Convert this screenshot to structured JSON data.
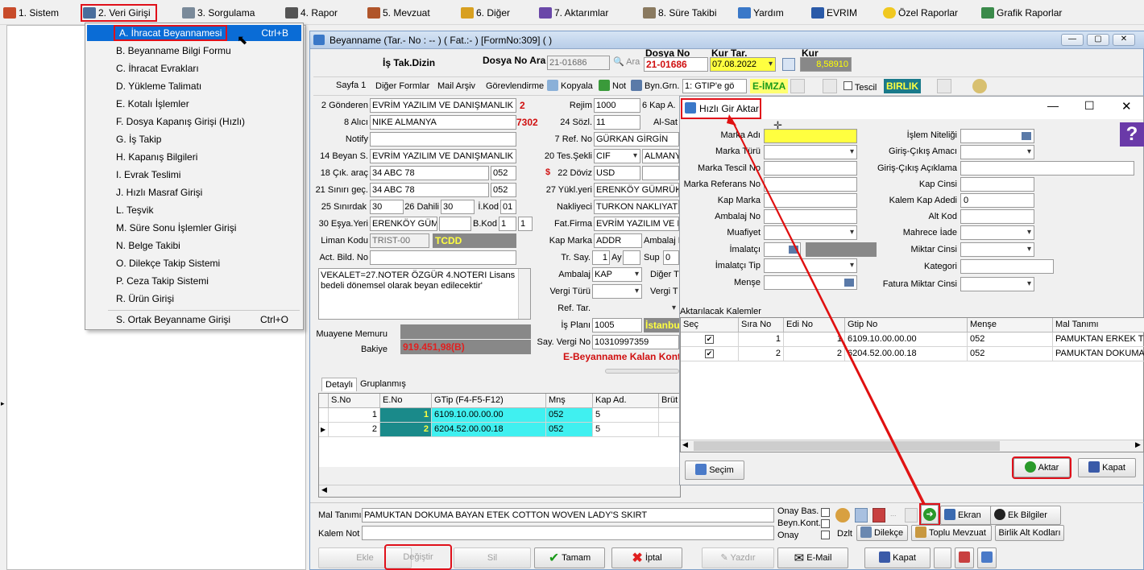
{
  "menubar": {
    "items": [
      {
        "label": "1.  Sistem",
        "icon": "system-icon"
      },
      {
        "label": "2.  Veri Girişi",
        "icon": "data-entry-icon"
      },
      {
        "label": "3.  Sorgulama",
        "icon": "query-icon"
      },
      {
        "label": "4.  Rapor",
        "icon": "printer-icon"
      },
      {
        "label": "5.  Mevzuat",
        "icon": "books-icon"
      },
      {
        "label": "6.  Diğer",
        "icon": "other-icon"
      },
      {
        "label": "7.  Aktarımlar",
        "icon": "transfer-icon"
      },
      {
        "label": "8. Süre Takibi",
        "icon": "clipboard-icon"
      },
      {
        "label": "Yardım",
        "icon": "help-icon"
      },
      {
        "label": "EVRIM",
        "icon": "evrim-icon"
      },
      {
        "label": "Özel Raporlar",
        "icon": "star-icon"
      },
      {
        "label": "Grafik Raporlar",
        "icon": "chart-icon"
      }
    ]
  },
  "dropdown": {
    "items": [
      {
        "label": "A.  İhracat Beyannamesi",
        "shortcut": "Ctrl+B"
      },
      {
        "label": "B.  Beyanname Bilgi Formu"
      },
      {
        "label": "C.  İhracat Evrakları"
      },
      {
        "label": "D.  Yükleme Talimatı"
      },
      {
        "label": "E.  Kotalı İşlemler"
      },
      {
        "label": "F.  Dosya Kapanış Girişi (Hızlı)"
      },
      {
        "label": "G.  İş Takip"
      },
      {
        "label": "H.  Kapanış Bilgileri"
      },
      {
        "label": "I.  Evrak Teslimi"
      },
      {
        "label": "J.  Hızlı Masraf Girişi"
      },
      {
        "label": "L.  Teşvik"
      },
      {
        "label": "M.  Süre Sonu İşlemler Girişi"
      },
      {
        "label": "N.  Belge Takibi"
      },
      {
        "label": "O.  Dilekçe Takip Sistemi"
      },
      {
        "label": "P.  Ceza Takip Sistemi"
      },
      {
        "label": "R.  Ürün Girişi"
      },
      {
        "label": "S.  Ortak Beyanname Girişi",
        "shortcut": "Ctrl+O"
      }
    ]
  },
  "window": {
    "title": "Beyanname (Tar.- No : -- ) ( Fat.:- ) [FormNo:309] ( )",
    "is_takip_label": "İş Tak.Dizin",
    "dosya_no_ara_label": "Dosya No Ara",
    "dosya_no_search": "21-01686",
    "ara_label": "Ara",
    "dosya_no_label": "Dosya No",
    "dosya_no": "21-01686",
    "kur_tar_label": "Kur Tar.",
    "kur_tar": "07.08.2022",
    "kur_label": "Kur",
    "kur": "8,58910"
  },
  "toolbar": {
    "sayfa1": "Sayfa 1",
    "diger_formlar": "Diğer Formlar",
    "mail_arsiv": "Mail Arşiv",
    "gorevlendirme": "Görevlendirme",
    "kopyala": "Kopyala",
    "not": "Not",
    "byn_grn": "Byn.Grn.",
    "gtip_select": "1: GTIP'e gö",
    "e_imza": "E-İMZA",
    "tescil": "Tescil",
    "birlik": "BIRLIK"
  },
  "form": {
    "gonderen_label": "2 Gönderen",
    "gonderen": "EVRİM YAZILIM VE DANIŞMANLIK L",
    "gonderen_code": "2",
    "alici_label": "8 Alıcı",
    "alici": "NIKE ALMANYA",
    "alici_code": "7302",
    "notify_label": "Notify",
    "notify": "",
    "beyan_label": "14 Beyan S.",
    "beyan": "EVRİM YAZILIM VE DANIŞMANLIK",
    "cik_arac_label": "18 Çık. araç",
    "cik_arac": "34 ABC 78",
    "cik_arac_code": "052",
    "sinir_gec_label": "21 Sınırı geç.",
    "sinir_gec": "34 ABC 78",
    "sinir_gec_code": "052",
    "sinirdak_label": "25 Sınırdak",
    "sinirdak": "30",
    "dahili_label": "26 Dahili",
    "dahili": "30",
    "ikod_label": "İ.Kod",
    "ikod": "01",
    "esya_yeri_label": "30 Eşya.Yeri",
    "esya_yeri": "ERENKÖY GÜM",
    "bkod_label": "B.Kod",
    "bkod": "1",
    "bkod2": "1",
    "liman_label": "Liman Kodu",
    "liman": "TRIST-00",
    "liman_name": "TCDD HAYDARPA",
    "act_bild_label": "Act. Bild. No",
    "act_bild": "",
    "note_text": "VEKALET=27.NOTER ÖZGÜR 4.NOTERI Lisans bedeli dönemsel olarak beyan edilecektir'",
    "muayene_label": "Muayene Memuru",
    "bakiye_label": "Bakiye",
    "bakiye": "919.451,98(B)",
    "rejim_label": "Rejim",
    "rejim": "1000",
    "kap_a_label": "6 Kap A.",
    "sozl_label": "24 Sözl.",
    "sozl": "11",
    "al_sat_label": "Al-Sat",
    "ref_no_label": "7 Ref. No",
    "ref_no": "GÜRKAN GİRGİN",
    "tes_sekli_label": "20 Tes.Şekli",
    "tes_sekli": "CIF",
    "tes_country": "ALMANY",
    "doviz_label": "22 Döviz",
    "doviz": "USD",
    "yukl_yeri_label": "27 Yükl.yeri",
    "yukl_yeri": "ERENKÖY GÜMRÜK",
    "nakliyeci_label": "Nakliyeci",
    "nakliyeci": "TURKON NAKLIYAT",
    "fat_firma_label": "Fat.Firma",
    "fat_firma": "EVRİM YAZILIM VE D",
    "kap_marka_label": "Kap Marka",
    "kap_marka": "ADDR",
    "ambalaj_n_label": "Ambalaj N",
    "tr_say_label": "Tr. Say.",
    "tr_say": "1",
    "ay_label": "Ay",
    "sup_label": "Sup",
    "sup": "0",
    "ambalaj_label": "Ambalaj",
    "ambalaj": "KAP",
    "diger_t_label": "Diğer T",
    "vergi_turu_label": "Vergi Türü",
    "vergi_t2_label": "Vergi T",
    "ref_tar_label": "Ref. Tar.",
    "is_plani_label": "İş Planı",
    "is_plani": "1005",
    "istanbul": "İstanbu",
    "say_vergi_label": "Say. Vergi No",
    "say_vergi": "10310997359",
    "e_beyanname": "E-Beyanname Kalan Kont"
  },
  "detail_tabs": [
    "Detaylı",
    "Gruplanmış"
  ],
  "detail_grid": {
    "headers": [
      "S.No",
      "E.No",
      "GTip (F4-F5-F12)",
      "Mnş",
      "Kap Ad.",
      "Brüt"
    ],
    "rows": [
      {
        "sno": "1",
        "eno": "1",
        "gtip": "6109.10.00.00.00",
        "mns": "052",
        "kap": "5"
      },
      {
        "sno": "2",
        "eno": "2",
        "gtip": "6204.52.00.00.18",
        "mns": "052",
        "kap": "5"
      }
    ]
  },
  "bottom": {
    "mal_tanimi_label": "Mal Tanımı",
    "mal_tanimi": "PAMUKTAN DOKUMA BAYAN ETEK COTTON WOVEN LADY'S SKIRT",
    "kalem_not_label": "Kalem Not",
    "onay_bas_label": "Onay Bas.",
    "beyn_kont_label": "Beyn.Kont.",
    "onay_label": "Onay",
    "dzlt_label": "Dzlt",
    "ekran": "Ekran",
    "ek_bilgiler": "Ek Bilgiler",
    "dilekce": "Dilekçe",
    "toplu_mevzuat": "Toplu Mevzuat",
    "birlik_alt": "Birlik Alt Kodları",
    "ekle": "Ekle",
    "degistir": "Değiştir",
    "sil": "Sil",
    "tamam": "Tamam",
    "iptal": "İptal",
    "yazdir": "Yazdır",
    "email": "E-Mail",
    "kapat": "Kapat"
  },
  "dialog": {
    "title": "Hızlı Gir Aktar",
    "left_labels": [
      "Marka Adı",
      "Marka Türü",
      "Marka Tescil No",
      "Marka Referans No",
      "Kap Marka",
      "Ambalaj No",
      "Muafiyet",
      "İmalatçı",
      "İmalatçı Tip",
      "Menşe"
    ],
    "right_labels": [
      "İşlem Niteliği",
      "Giriş-Çıkış Amacı",
      "Giriş-Çıkış Açıklama",
      "Kap Cinsi",
      "Kalem Kap Adedi",
      "Alt Kod",
      "Mahrece İade",
      "Miktar Cinsi",
      "Kategori",
      "Fatura Miktar Cinsi"
    ],
    "kalem_kap_adedi": "0",
    "list_title": "Aktarılacak Kalemler",
    "headers": [
      "Seç",
      "Sıra No",
      "Edi No",
      "Gtip No",
      "Menşe",
      "Mal Tanımı"
    ],
    "rows": [
      {
        "sira": "1",
        "edi": "1",
        "gtip": "6109.10.00.00.00",
        "mense": "052",
        "mal": "PAMUKTAN ERKEK T"
      },
      {
        "sira": "2",
        "edi": "2",
        "gtip": "6204.52.00.00.18",
        "mense": "052",
        "mal": "PAMUKTAN DOKUMA"
      }
    ],
    "secim": "Seçim",
    "aktar": "Aktar",
    "kapat": "Kapat"
  }
}
